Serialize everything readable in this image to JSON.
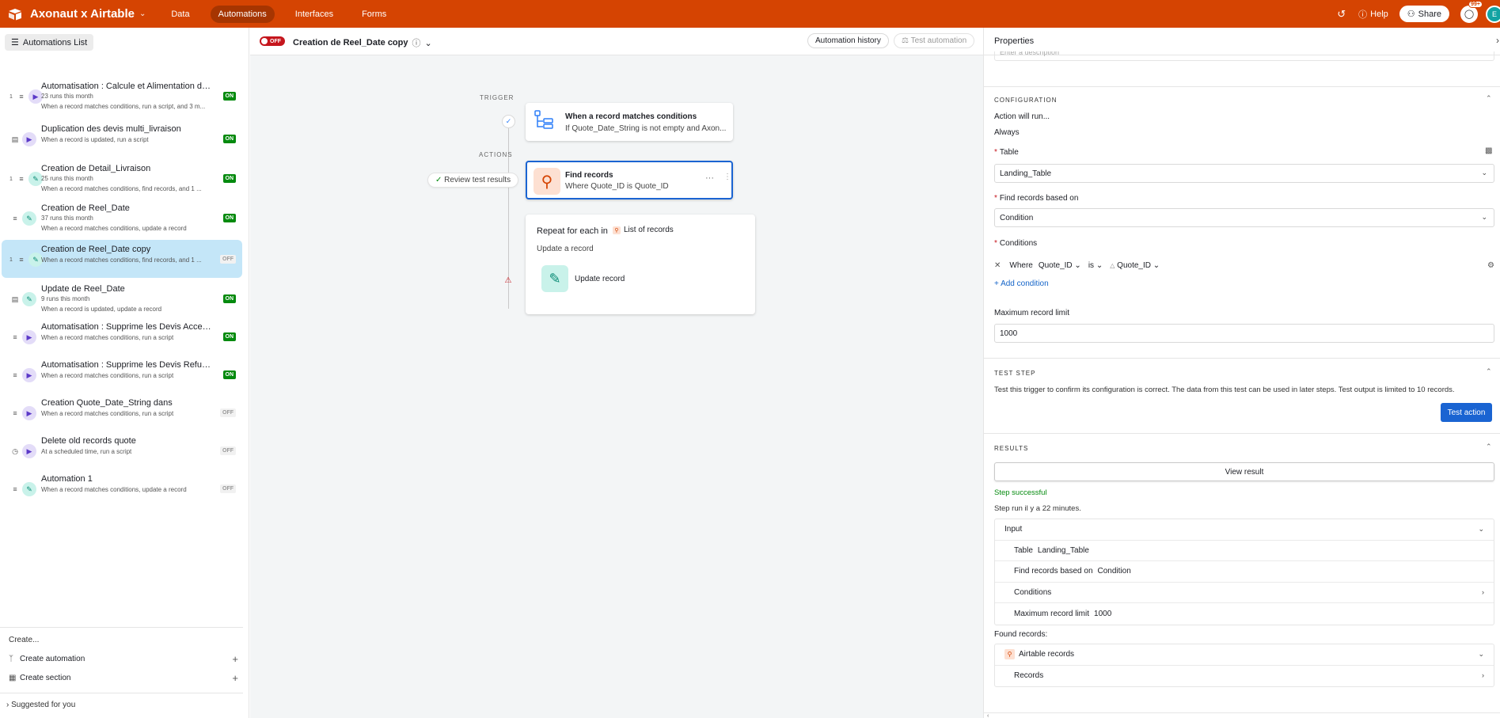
{
  "topbar": {
    "base_name": "Axonaut x Airtable",
    "tabs": [
      {
        "label": "Data",
        "active": false
      },
      {
        "label": "Automations",
        "active": true
      },
      {
        "label": "Interfaces",
        "active": false
      },
      {
        "label": "Forms",
        "active": false
      }
    ],
    "help_label": "Help",
    "share_label": "Share",
    "notif_count": "99+",
    "accent_color": "#d54402"
  },
  "sidebar": {
    "list_button_label": "Automations List",
    "automations": [
      {
        "name": "Automatisation : Calcule et Alimentation des t...",
        "runs": "23 runs this month",
        "desc": "When a record matches conditions, run a script, and 3 m...",
        "status": "ON",
        "trigger_icon": "conditions-icon",
        "action": "script",
        "count": "1"
      },
      {
        "name": "Duplication des devis multi_livraison",
        "runs": "",
        "desc": "When a record is updated, run a script",
        "status": "ON",
        "trigger_icon": "record-updated-icon",
        "action": "script",
        "count": ""
      },
      {
        "name": "Creation de Detail_Livraison",
        "runs": "25 runs this month",
        "desc": "When a record matches conditions, find records, and 1 ...",
        "status": "ON",
        "trigger_icon": "conditions-icon",
        "action": "update",
        "count": "1"
      },
      {
        "name": "Creation de Reel_Date",
        "runs": "37 runs this month",
        "desc": "When a record matches conditions, update a record",
        "status": "ON",
        "trigger_icon": "conditions-icon",
        "action": "update",
        "count": ""
      },
      {
        "name": "Creation de Reel_Date copy",
        "runs": "",
        "desc": "When a record matches conditions, find records, and 1 ...",
        "status": "OFF",
        "trigger_icon": "conditions-icon",
        "action": "update",
        "count": "1"
      },
      {
        "name": "Update de Reel_Date",
        "runs": "9 runs this month",
        "desc": "When a record is updated, update a record",
        "status": "ON",
        "trigger_icon": "record-updated-icon",
        "action": "update",
        "count": ""
      },
      {
        "name": "Automatisation : Supprime les Devis Accepted...",
        "runs": "",
        "desc": "When a record matches conditions, run a script",
        "status": "ON",
        "trigger_icon": "conditions-icon",
        "action": "script",
        "count": ""
      },
      {
        "name": "Automatisation : Supprime les Devis Refused",
        "runs": "",
        "desc": "When a record matches conditions, run a script",
        "status": "ON",
        "trigger_icon": "conditions-icon",
        "action": "script",
        "count": ""
      },
      {
        "name": "Creation Quote_Date_String dans",
        "runs": "",
        "desc": "When a record matches conditions, run a script",
        "status": "OFF",
        "trigger_icon": "conditions-icon",
        "action": "script",
        "count": ""
      },
      {
        "name": "Delete old records quote",
        "runs": "",
        "desc": "At a scheduled time, run a script",
        "status": "OFF",
        "trigger_icon": "clock-icon",
        "action": "script",
        "count": ""
      },
      {
        "name": "Automation 1",
        "runs": "",
        "desc": "When a record matches conditions, update a record",
        "status": "OFF",
        "trigger_icon": "conditions-icon",
        "action": "update",
        "count": ""
      }
    ],
    "selected_index": 4,
    "create_label": "Create...",
    "create_automation_label": "Create automation",
    "create_section_label": "Create section",
    "suggested_label": "Suggested for you"
  },
  "canvas": {
    "toggle_label": "OFF",
    "title": "Creation de Reel_Date copy",
    "history_label": "Automation history",
    "test_label": "Test automation",
    "trigger_label": "TRIGGER",
    "actions_label": "ACTIONS",
    "trigger_card": {
      "title": "When a record matches conditions",
      "sub": "If Quote_Date_String is not empty and Axon..."
    },
    "find_card": {
      "title": "Find records",
      "sub": "Where Quote_ID is Quote_ID"
    },
    "review_label": "Review test results",
    "repeat_card": {
      "title": "Repeat for each in",
      "list_label": "List of records",
      "sub": "Update a record",
      "inner_label": "Update record"
    }
  },
  "properties": {
    "title": "Properties",
    "description_placeholder": "Enter a description",
    "configuration_label": "CONFIGURATION",
    "action_will_run_label": "Action will run...",
    "action_will_run_value": "Always",
    "table_label": "Table",
    "table_value": "Landing_Table",
    "find_based_label": "Find records based on",
    "find_based_value": "Condition",
    "conditions_label": "Conditions",
    "condition": {
      "where": "Where",
      "field": "Quote_ID",
      "op": "is",
      "value": "Quote_ID"
    },
    "add_condition_label": "Add condition",
    "max_limit_label": "Maximum record limit",
    "max_limit_value": "1000",
    "test_step_label": "TEST STEP",
    "test_desc": "Test this trigger to confirm its configuration is correct. The data from this test can be used in later steps. Test output is limited to 10 records.",
    "test_button_label": "Test action",
    "results_label": "RESULTS",
    "view_result_label": "View result",
    "success_label": "Step successful",
    "step_run_label": "Step run il y a 22 minutes.",
    "input_label": "Input",
    "input_rows": [
      {
        "key": "Table",
        "value": "Landing_Table",
        "chevron": false
      },
      {
        "key": "Find records based on",
        "value": "Condition",
        "chevron": false
      },
      {
        "key": "Conditions",
        "value": "",
        "chevron": true
      },
      {
        "key": "Maximum record limit",
        "value": "1000",
        "chevron": false
      }
    ],
    "found_records_label": "Found records:",
    "airtable_records_label": "Airtable records",
    "records_label": "Records"
  }
}
